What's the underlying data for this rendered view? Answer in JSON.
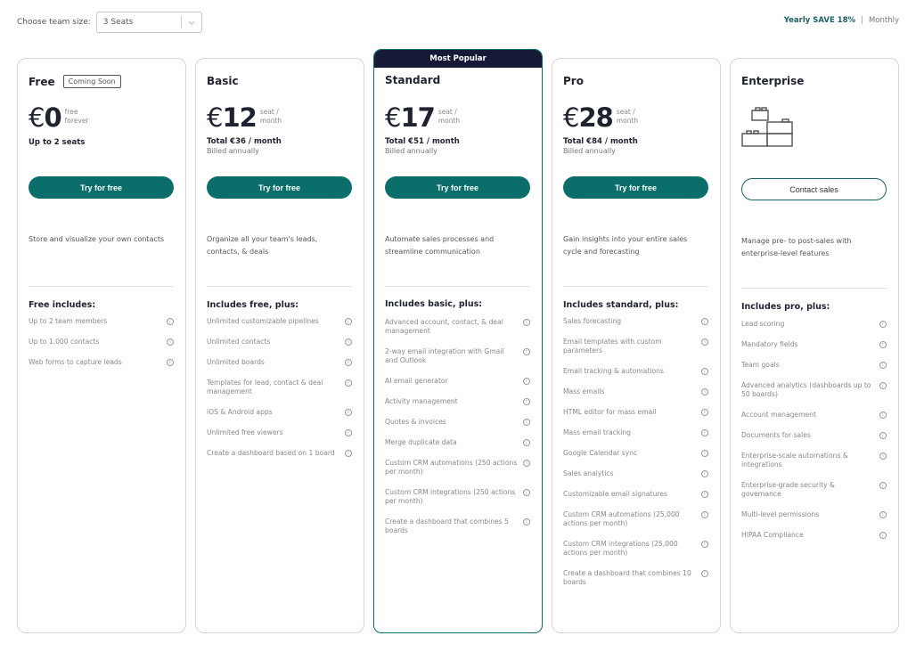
{
  "topbar": {
    "team_size_label": "Choose team size:",
    "seat_select_value": "3 Seats",
    "billing_yearly": "Yearly SAVE 18%",
    "billing_separator": "|",
    "billing_monthly": "Monthly"
  },
  "colors": {
    "brand": "#0b6e6b",
    "banner": "#161a36",
    "yearly_text": "#1d5f66"
  },
  "plans": [
    {
      "name": "Free",
      "badge": "Coming Soon",
      "currency": "€",
      "price": "0",
      "unit": "free forever",
      "seats_note": "Up to 2 seats",
      "cta": "Try for free",
      "description": "Store and visualize your own contacts",
      "includes_title": "Free includes:",
      "features": [
        "Up to 2 team members",
        "Up to 1,000 contacts",
        "Web forms to capture leads"
      ]
    },
    {
      "name": "Basic",
      "currency": "€",
      "price": "12",
      "unit": "seat / month",
      "total": "Total €36  / month",
      "billed": "Billed annually",
      "cta": "Try for free",
      "description": "Organize all your team's leads, contacts, & deals",
      "includes_title": "Includes free, plus:",
      "features": [
        "Unlimited customizable pipelines",
        "Unlimited contacts",
        "Unlimited boards",
        "Templates for lead, contact & deal management",
        "iOS & Android apps",
        "Unlimited free viewers",
        "Create a dashboard based on 1 board"
      ]
    },
    {
      "name": "Standard",
      "banner": "Most Popular",
      "currency": "€",
      "price": "17",
      "unit": "seat / month",
      "total": "Total €51  / month",
      "billed": "Billed annually",
      "cta": "Try for free",
      "description": "Automate sales processes and streamline communication",
      "includes_title": "Includes basic, plus:",
      "features": [
        "Advanced account, contact, & deal management",
        "2-way email integration with Gmail and Outlook",
        "AI email generator",
        "Activity management",
        "Quotes & invoices",
        "Merge duplicate data",
        "Custom CRM automations (250 actions per month)",
        "Custom CRM integrations (250 actions per month)",
        "Create a dashboard that combines 5 boards"
      ]
    },
    {
      "name": "Pro",
      "currency": "€",
      "price": "28",
      "unit": "seat / month",
      "total": "Total €84  / month",
      "billed": "Billed annually",
      "cta": "Try for free",
      "description": "Gain insights into your entire sales cycle and forecasting",
      "includes_title": "Includes standard, plus:",
      "features": [
        "Sales forecasting",
        "Email templates with custom parameters",
        "Email tracking & automations",
        "Mass emails",
        "HTML editor for mass email",
        "Mass email tracking",
        "Google Calendar sync",
        "Sales analytics",
        "Customizable email signatures",
        "Custom CRM automations (25,000 actions per month)",
        "Custom CRM integrations (25,000 actions per month)",
        "Create a dashboard that combines 10 boards"
      ]
    },
    {
      "name": "Enterprise",
      "icon": "building-blocks-icon",
      "cta": "Contact sales",
      "description": "Manage pre- to post-sales with enterprise-level features",
      "includes_title": "Includes pro, plus:",
      "features": [
        "Lead scoring",
        "Mandatory fields",
        "Team goals",
        "Advanced analytics (dashboards up to 50 boards)",
        "Account management",
        "Documents for sales",
        "Enterprise-scale automations & integrations",
        "Enterprise-grade security & governance",
        "Multi-level permissions",
        "HIPAA Compliance"
      ]
    }
  ]
}
